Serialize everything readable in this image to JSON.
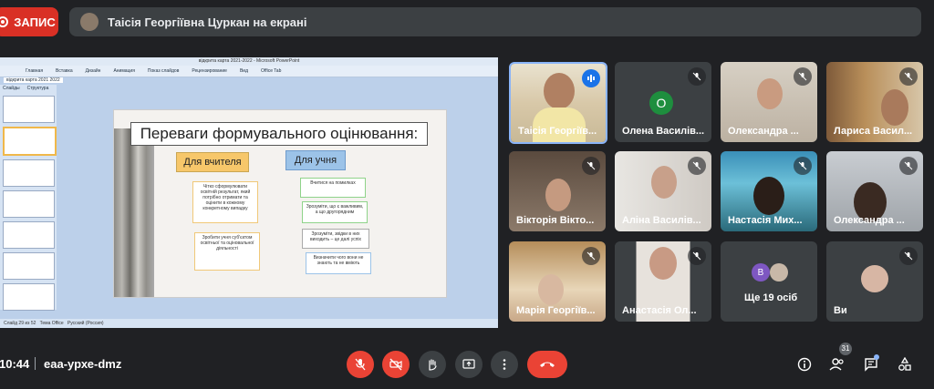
{
  "recording": {
    "label": "ЗАПИС"
  },
  "presenting": {
    "text": "Таісія Георгіївна Цуркан на екрані"
  },
  "ppt": {
    "window_title": "відкрита карта 2021-2022 - Microsoft PowerPoint",
    "ribbon_tabs": [
      "Главная",
      "Вставка",
      "Дизайн",
      "Анимация",
      "Показ слайдов",
      "Рецензирование",
      "Вид",
      "Office Tab"
    ],
    "tab_label": "відкрита карта 2021 2022",
    "left_tabs": [
      "Слайды",
      "Структура"
    ],
    "status": [
      "Слайд 29 из 52",
      "Тема Office",
      "Русский (Россия)"
    ],
    "slide": {
      "title": "Переваги формувального оцінювання:",
      "teacher_header": "Для вчителя",
      "student_header": "Для учня",
      "teacher_items": [
        "Чітко сформулювати освітній результат, який потрібно отримати та оцінити в кожному конкретному випадку",
        "Зробити учня суб'єктом освітньої та оціновальної діяльності"
      ],
      "student_items": [
        "Вчитися на помилках",
        "Зрозуміти, що є важливим, а що другорядним",
        "Зрозуміти, звідки в них виходить – це далі успіх",
        "Визначити чого вони не знають та не вміють"
      ]
    }
  },
  "participants": [
    {
      "name": "Таісія Георгіїв...",
      "speaking": true
    },
    {
      "name": "Олена Василів...",
      "initial": "О",
      "color": "#1e8e3e"
    },
    {
      "name": "Олександра ..."
    },
    {
      "name": "Лариса Васил..."
    },
    {
      "name": "Вікторія Вікто..."
    },
    {
      "name": "Аліна Василів..."
    },
    {
      "name": "Настасія Мих..."
    },
    {
      "name": "Олександра ..."
    },
    {
      "name": "Марія Георгіїв..."
    },
    {
      "name": "Анастасія Ол..."
    },
    {
      "name": "Ще 19 осіб",
      "initial": "В"
    },
    {
      "name": "Ви"
    }
  ],
  "bottom": {
    "time": "10:44",
    "meeting_code": "еаа-урхе-dmz",
    "participant_count": "31"
  },
  "colors": {
    "danger": "#ea4335",
    "tile": "#3c4043",
    "background": "#202124"
  }
}
